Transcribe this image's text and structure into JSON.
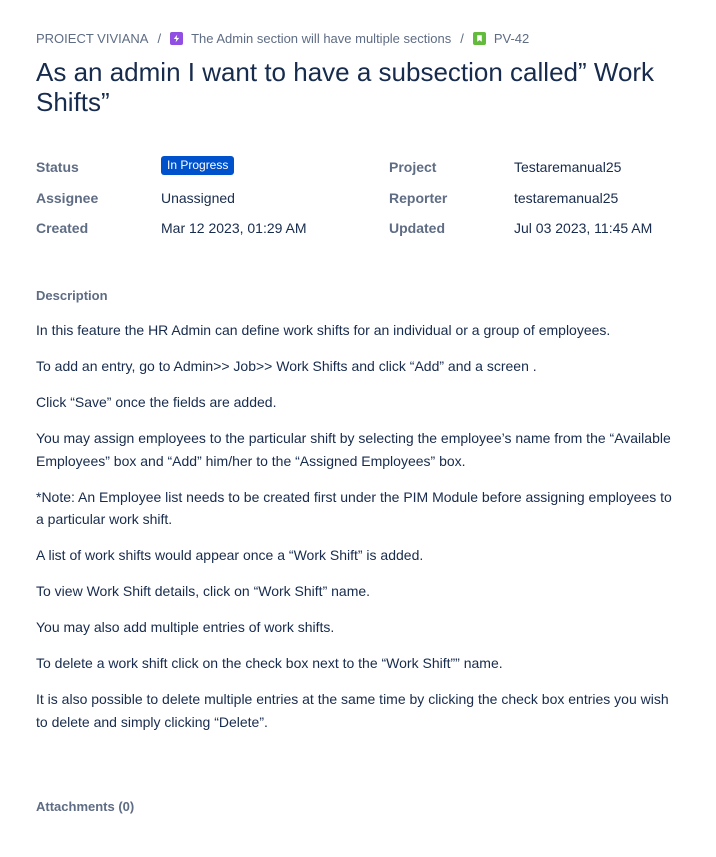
{
  "breadcrumb": {
    "project": "PROIECT VIVIANA",
    "separator": "/",
    "epic_label": "The Admin section will have multiple sections",
    "epic_icon_color": "#904ee2",
    "issue_key": "PV-42",
    "story_icon_color": "#63ba3c"
  },
  "issue": {
    "title": "As an admin I want to have a subsection called” Work Shifts”"
  },
  "fields": {
    "status_label": "Status",
    "status_value": "In Progress",
    "status_color": "#0052cc",
    "project_label": "Project",
    "project_value": "Testaremanual25",
    "assignee_label": "Assignee",
    "assignee_value": "Unassigned",
    "reporter_label": "Reporter",
    "reporter_value": "testaremanual25",
    "created_label": "Created",
    "created_value": "Mar 12 2023, 01:29 AM",
    "updated_label": "Updated",
    "updated_value": "Jul 03 2023, 11:45 AM"
  },
  "description": {
    "label": "Description",
    "paragraphs": [
      "In this feature the HR Admin can define work shifts for an individual or a group of employees.",
      "To add an entry, go to Admin>> Job>> Work Shifts and click “Add” and a screen .",
      "Click “Save” once the fields are added.",
      "You may assign employees to the particular shift by selecting the employee’s name from the “Available Employees” box and “Add” him/her to the “Assigned Employees” box.",
      "*Note: An Employee list needs to be created first under the PIM Module before assigning employees to a particular work shift.",
      "A list of work shifts would appear once a “Work Shift” is added.",
      "To view Work Shift details, click on “Work Shift” name.",
      "You may also add multiple entries of work shifts.",
      "To delete a work shift click on the check box next to the “Work Shift”” name.",
      "It is also possible to delete multiple entries at the same time by clicking the check box entries you wish to delete and simply clicking “Delete”."
    ]
  },
  "attachments": {
    "label": "Attachments (0)"
  }
}
